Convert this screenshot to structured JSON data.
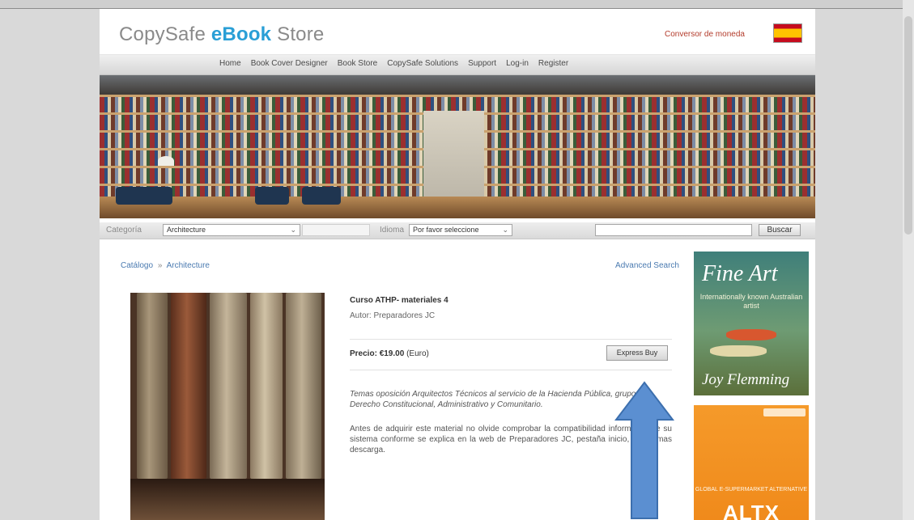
{
  "header": {
    "logo_part1": "CopySafe",
    "logo_part2": "eBook",
    "logo_part3": "Store",
    "currency_converter": "Conversor de moneda",
    "flag": "spain-flag-icon"
  },
  "nav": {
    "items": [
      "Home",
      "Book Cover Designer",
      "Book Store",
      "CopySafe Solutions",
      "Support",
      "Log-in",
      "Register"
    ]
  },
  "filters": {
    "category_label": "Categoría",
    "category_value": "Architecture",
    "language_label": "Idioma",
    "language_value": "Por favor seleccione",
    "search_button": "Buscar"
  },
  "breadcrumb": {
    "root": "Catálogo",
    "separator": "»",
    "current": "Architecture"
  },
  "advanced_search": "Advanced Search",
  "product": {
    "title": "Curso ATHP- materiales 4",
    "author": "Autor: Preparadores JC",
    "price_label": "Precio:",
    "price_value": "€19.00",
    "currency": "(Euro)",
    "buy_button": "Express Buy",
    "description_italic": "Temas oposición Arquitectos Técnicos al servicio de la Hacienda Pública, grupo IV, Derecho Constitucional, Administrativo y Comunitario.",
    "description_text": "Antes de adquirir este material no olvide comprobar la compatibilidad informática de su sistema conforme se explica en la web de Preparadores JC, pestaña inicio, Programas descarga."
  },
  "ads": {
    "ad1_title": "Fine Art",
    "ad1_subtitle": "Internationally known Australian artist",
    "ad1_name": "Joy Flemming",
    "ad2_line": "GLOBAL E-SUPERMARKET ALTERNATIVE",
    "ad2_big": "ALTX"
  },
  "colors": {
    "accent": "#2a9fd6",
    "arrow": "#5b8fd1",
    "link": "#4a7ab0"
  }
}
